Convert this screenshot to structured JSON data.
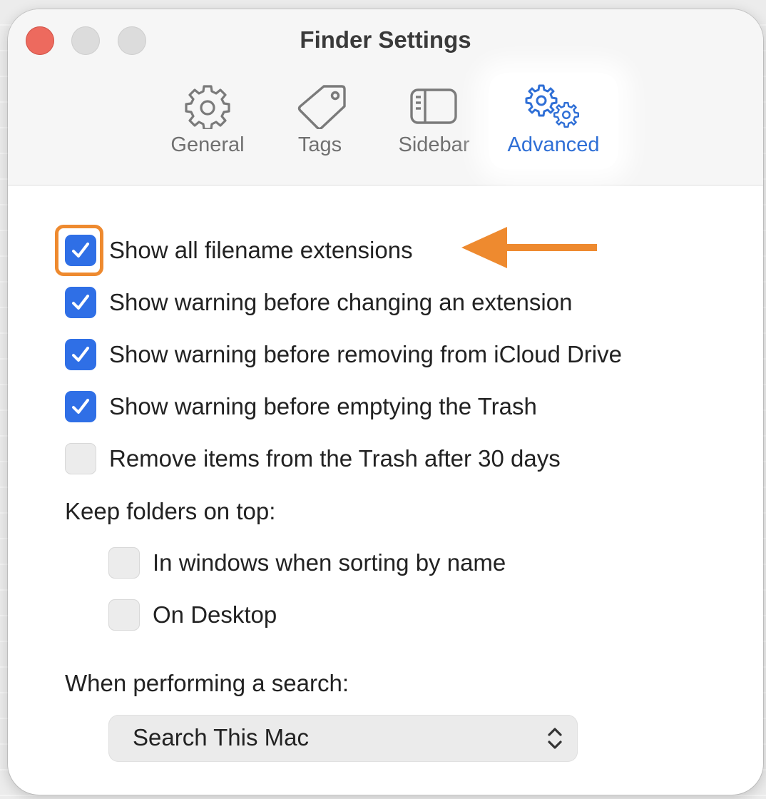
{
  "window": {
    "title": "Finder Settings"
  },
  "tabs": [
    {
      "label": "General",
      "icon": "gear-icon"
    },
    {
      "label": "Tags",
      "icon": "tag-icon"
    },
    {
      "label": "Sidebar",
      "icon": "sidebar-icon"
    },
    {
      "label": "Advanced",
      "icon": "gears-icon",
      "selected": true
    }
  ],
  "options": [
    {
      "label": "Show all filename extensions",
      "checked": true,
      "highlighted": true
    },
    {
      "label": "Show warning before changing an extension",
      "checked": true
    },
    {
      "label": "Show warning before removing from iCloud Drive",
      "checked": true
    },
    {
      "label": "Show warning before emptying the Trash",
      "checked": true
    },
    {
      "label": "Remove items from the Trash after 30 days",
      "checked": false
    }
  ],
  "keep_folders": {
    "heading": "Keep folders on top:",
    "options": [
      {
        "label": "In windows when sorting by name",
        "checked": false
      },
      {
        "label": "On Desktop",
        "checked": false
      }
    ]
  },
  "search": {
    "heading": "When performing a search:",
    "value": "Search This Mac"
  },
  "colors": {
    "accent": "#2f6fe6",
    "selected_tab_text": "#2f6fd6",
    "annotation": "#ee8a2f",
    "close_button": "#ed6a5e"
  }
}
